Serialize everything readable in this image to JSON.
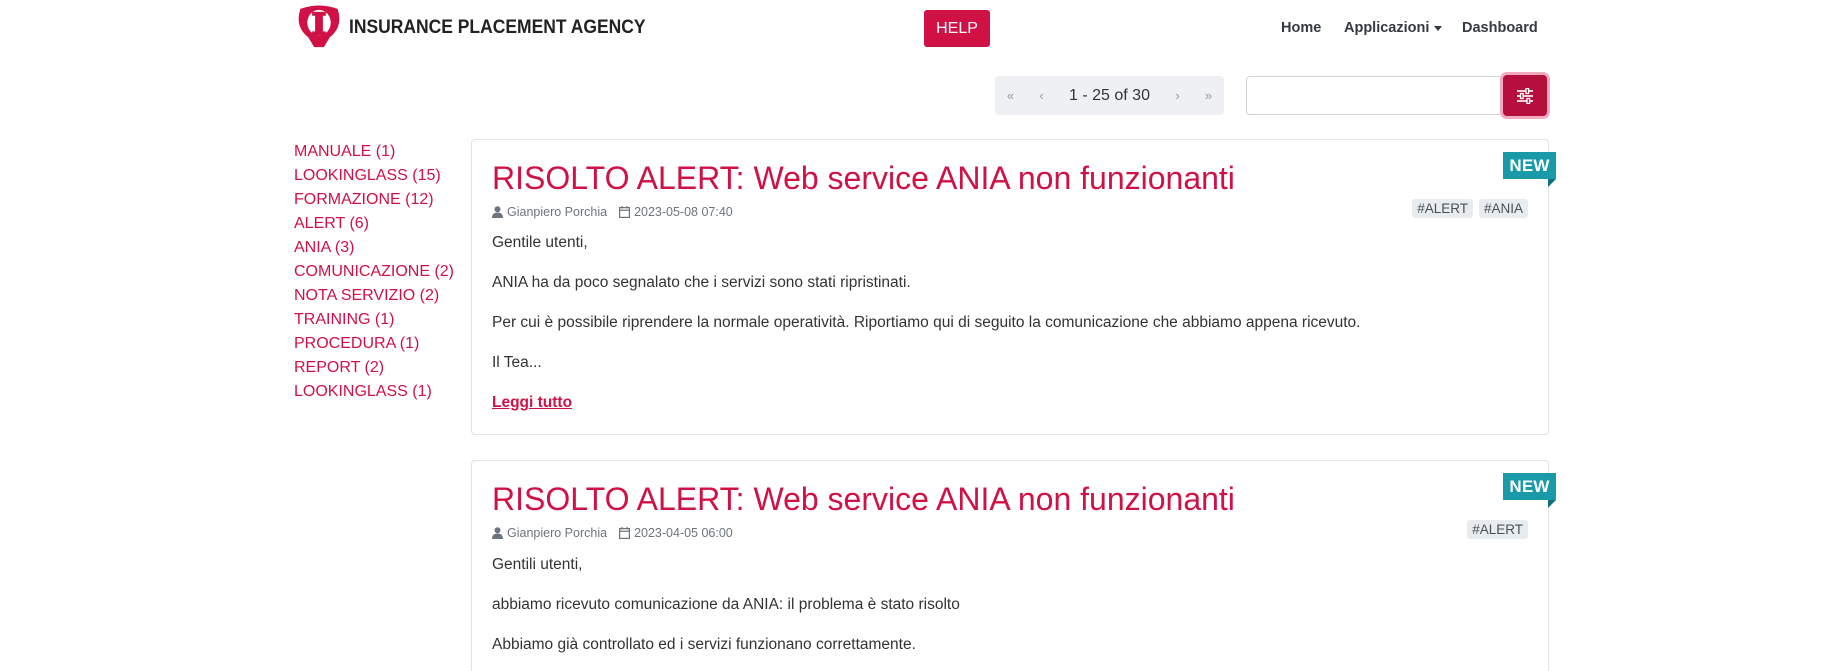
{
  "header": {
    "brand": "INSURANCE PLACEMENT AGENCY",
    "help_label": "HELP",
    "nav": {
      "home": "Home",
      "apps": "Applicazioni",
      "dashboard": "Dashboard"
    }
  },
  "pagination": {
    "first": "«",
    "prev": "‹",
    "info": "1 - 25 of 30",
    "next": "›",
    "last": "»"
  },
  "search": {
    "value": "",
    "placeholder": ""
  },
  "colors": {
    "brand": "#d01146",
    "ribbon": "#1a9aa8",
    "filter_button": "#b5103d"
  },
  "icons": {
    "user": "user-icon",
    "calendar": "calendar-icon",
    "filter": "sliders-icon"
  },
  "sidebar": {
    "categories": [
      "MANUALE (1)",
      "LOOKINGLASS (15)",
      "FORMAZIONE (12)",
      "ALERT (6)",
      "ANIA (3)",
      "COMUNICAZIONE (2)",
      "NOTA SERVIZIO (2)",
      "TRAINING (1)",
      "PROCEDURA (1)",
      "REPORT (2)",
      "LOOKINGLASS (1)"
    ]
  },
  "posts": [
    {
      "badge": "NEW",
      "title": "RISOLTO ALERT: Web service ANIA non funzionanti",
      "author": "Gianpiero Porchia",
      "date": "2023-05-08 07:40",
      "tags": [
        "#ALERT",
        "#ANIA"
      ],
      "paragraphs": [
        "Gentile utenti,",
        "ANIA ha da poco segnalato che i servizi sono stati ripristinati.",
        "Per cui è possibile riprendere la normale operatività. Riportiamo qui di seguito la comunicazione che abbiamo appena ricevuto.",
        "Il Tea..."
      ],
      "read_more": "Leggi tutto"
    },
    {
      "badge": "NEW",
      "title": "RISOLTO ALERT: Web service ANIA non funzionanti",
      "author": "Gianpiero Porchia",
      "date": "2023-04-05 06:00",
      "tags": [
        "#ALERT"
      ],
      "paragraphs": [
        "Gentili utenti,",
        "abbiamo ricevuto comunicazione da ANIA: il problema è stato risolto",
        "Abbiamo già controllato ed i servizi funzionano correttamente."
      ]
    }
  ]
}
